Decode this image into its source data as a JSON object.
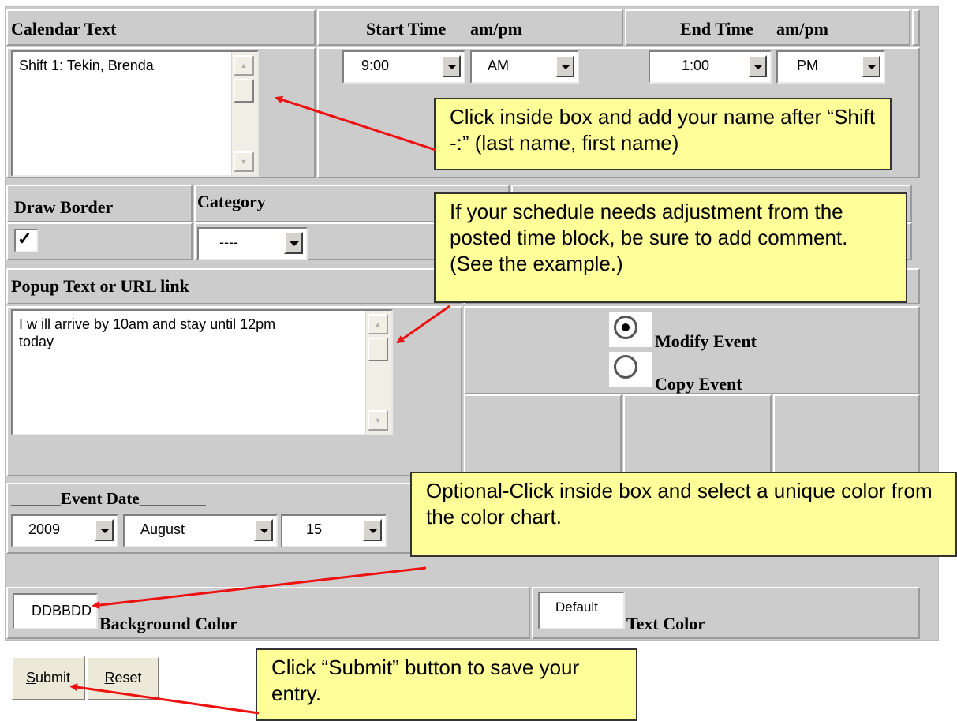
{
  "headers": {
    "calendar_text": "Calendar Text",
    "start_time": "Start Time",
    "am_pm_1": "am/pm",
    "end_time": "End Time",
    "am_pm_2": "am/pm",
    "draw_border": "Draw Border",
    "category": "Category",
    "popup_text": "Popup Text or URL link",
    "event_date": "______Event Date________",
    "background_color": "Background Color",
    "text_color": "Text Color"
  },
  "fields": {
    "calendar_text_value": "Shift 1: Tekin, Brenda",
    "start_time_value": "9:00",
    "start_ampm_value": "AM",
    "end_time_value": "1:00",
    "end_ampm_value": "PM",
    "category_value": "----",
    "popup_text_value": "I w ill arrive by 10am and stay until 12pm\ntoday",
    "year_value": "2009",
    "month_value": "August",
    "day_value": "15",
    "background_color_value": "DDBBDD",
    "text_color_value": "Default",
    "draw_border_checked": true
  },
  "radios": {
    "modify_label": "Modify Event",
    "copy_label": "Copy Event",
    "selected": "modify"
  },
  "buttons": {
    "submit_mnemonic": "S",
    "submit_rest": "ubmit",
    "reset_mnemonic": "R",
    "reset_rest": "eset"
  },
  "callouts": {
    "name_tip": "Click inside box and add your name after “Shift -:”  (last name, first name)",
    "comment_tip": "If your schedule needs adjustment from the posted time block, be sure to add comment. (See the example.)",
    "color_tip": "Optional-Click inside box and select a unique color from the color chart.",
    "submit_tip": "Click “Submit” button to save your entry."
  },
  "colors": {
    "form_background": "#cccccc",
    "callout_fill": "#ffff99",
    "arrow": "#ee1111"
  }
}
